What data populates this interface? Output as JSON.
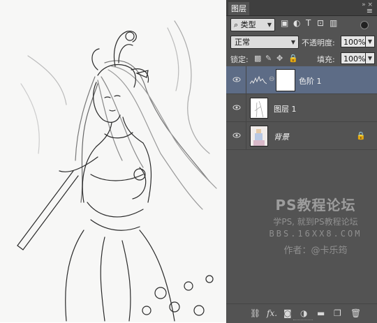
{
  "panel": {
    "tab_title": "图层",
    "filter": {
      "label": "类型",
      "icons": [
        "image-filter-icon",
        "adjustment-filter-icon",
        "type-filter-icon",
        "shape-filter-icon",
        "smart-object-filter-icon"
      ]
    },
    "blend_mode": "正常",
    "opacity_label": "不透明度:",
    "opacity_value": "100%",
    "lock_label": "锁定:",
    "fill_label": "填充:",
    "fill_value": "100%"
  },
  "layers": [
    {
      "name": "色阶 1",
      "type": "adjustment",
      "selected": true,
      "visible": true
    },
    {
      "name": "图层 1",
      "type": "pixel",
      "selected": false,
      "visible": true
    },
    {
      "name": "背景",
      "type": "background",
      "selected": false,
      "visible": true,
      "locked": true
    }
  ],
  "watermark": {
    "title": "PS教程论坛",
    "line2": "学PS, 就到PS教程论坛",
    "line3": "BBS.16XX8.COM",
    "author": "作者：@卡乐筠"
  },
  "bottom_icons": [
    "link-layers-icon",
    "fx-icon",
    "mask-icon",
    "adjustment-icon",
    "group-icon",
    "new-layer-icon",
    "delete-icon"
  ],
  "icons": {
    "fx_text": "fx.",
    "link_glyph": "⊖"
  }
}
